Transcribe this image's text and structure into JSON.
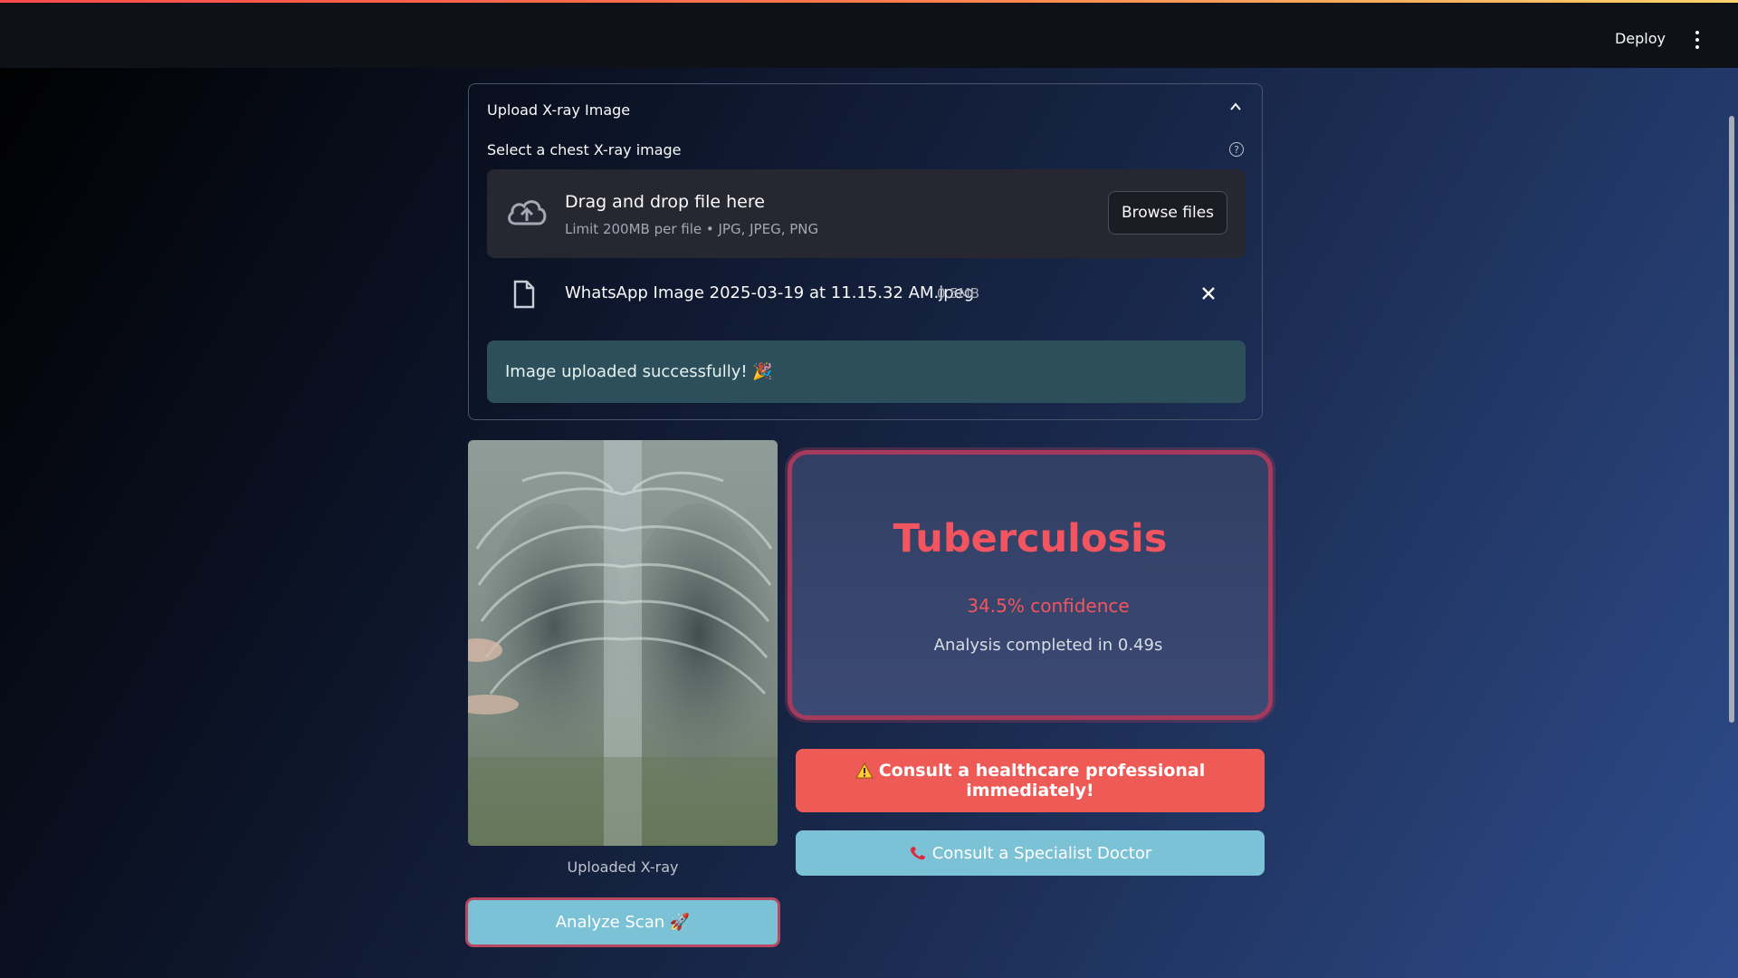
{
  "header": {
    "deploy_label": "Deploy",
    "menu_icon": "kebab-menu-icon"
  },
  "uploader": {
    "expander_title": "Upload X-ray Image",
    "select_label": "Select a chest X-ray image",
    "help_icon": "question-circle-icon",
    "dropzone": {
      "main_text": "Drag and drop file here",
      "sub_text": "Limit 200MB per file • JPG, JPEG, PNG",
      "browse_label": "Browse files",
      "icon": "cloud-upload-icon"
    },
    "file": {
      "name": "WhatsApp Image 2025-03-19 at 11.15.32 AM.jpeg",
      "size": "0.5MB",
      "icon": "file-icon"
    },
    "success_message": "Image uploaded successfully! 🎉"
  },
  "image": {
    "caption": "Uploaded X-ray"
  },
  "result": {
    "diagnosis": "Tuberculosis",
    "confidence_text": "34.5% confidence",
    "time_text": "Analysis completed in 0.49s",
    "accent_color": "#f25560"
  },
  "actions": {
    "analyze_label": "Analyze Scan 🚀",
    "warning_label": "Consult a healthcare professional immediately!",
    "warning_icon": "warning-icon",
    "doctor_label": "Consult a Specialist Doctor",
    "doctor_icon": "phone-icon"
  }
}
